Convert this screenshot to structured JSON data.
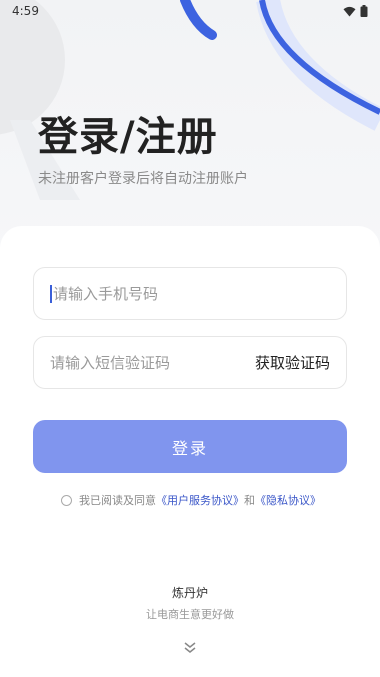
{
  "status_bar": {
    "time": "4:59"
  },
  "hero": {
    "title": "登录/注册",
    "subtitle": "未注册客户登录后将自动注册账户"
  },
  "form": {
    "phone_placeholder": "请输入手机号码",
    "phone_value": "",
    "code_placeholder": "请输入短信验证码",
    "code_value": "",
    "get_code_label": "获取验证码",
    "login_label": "登录"
  },
  "agreement": {
    "prefix": "我已阅读及同意",
    "user_agreement": "《用户服务协议》",
    "conjunction": "和",
    "privacy_policy": "《隐私协议》",
    "checked": false
  },
  "footer": {
    "brand": "炼丹炉",
    "slogan": "让电商生意更好做"
  },
  "colors": {
    "accent": "#8095ee",
    "link": "#3a56c8",
    "decor_blue": "#3d63e0"
  }
}
